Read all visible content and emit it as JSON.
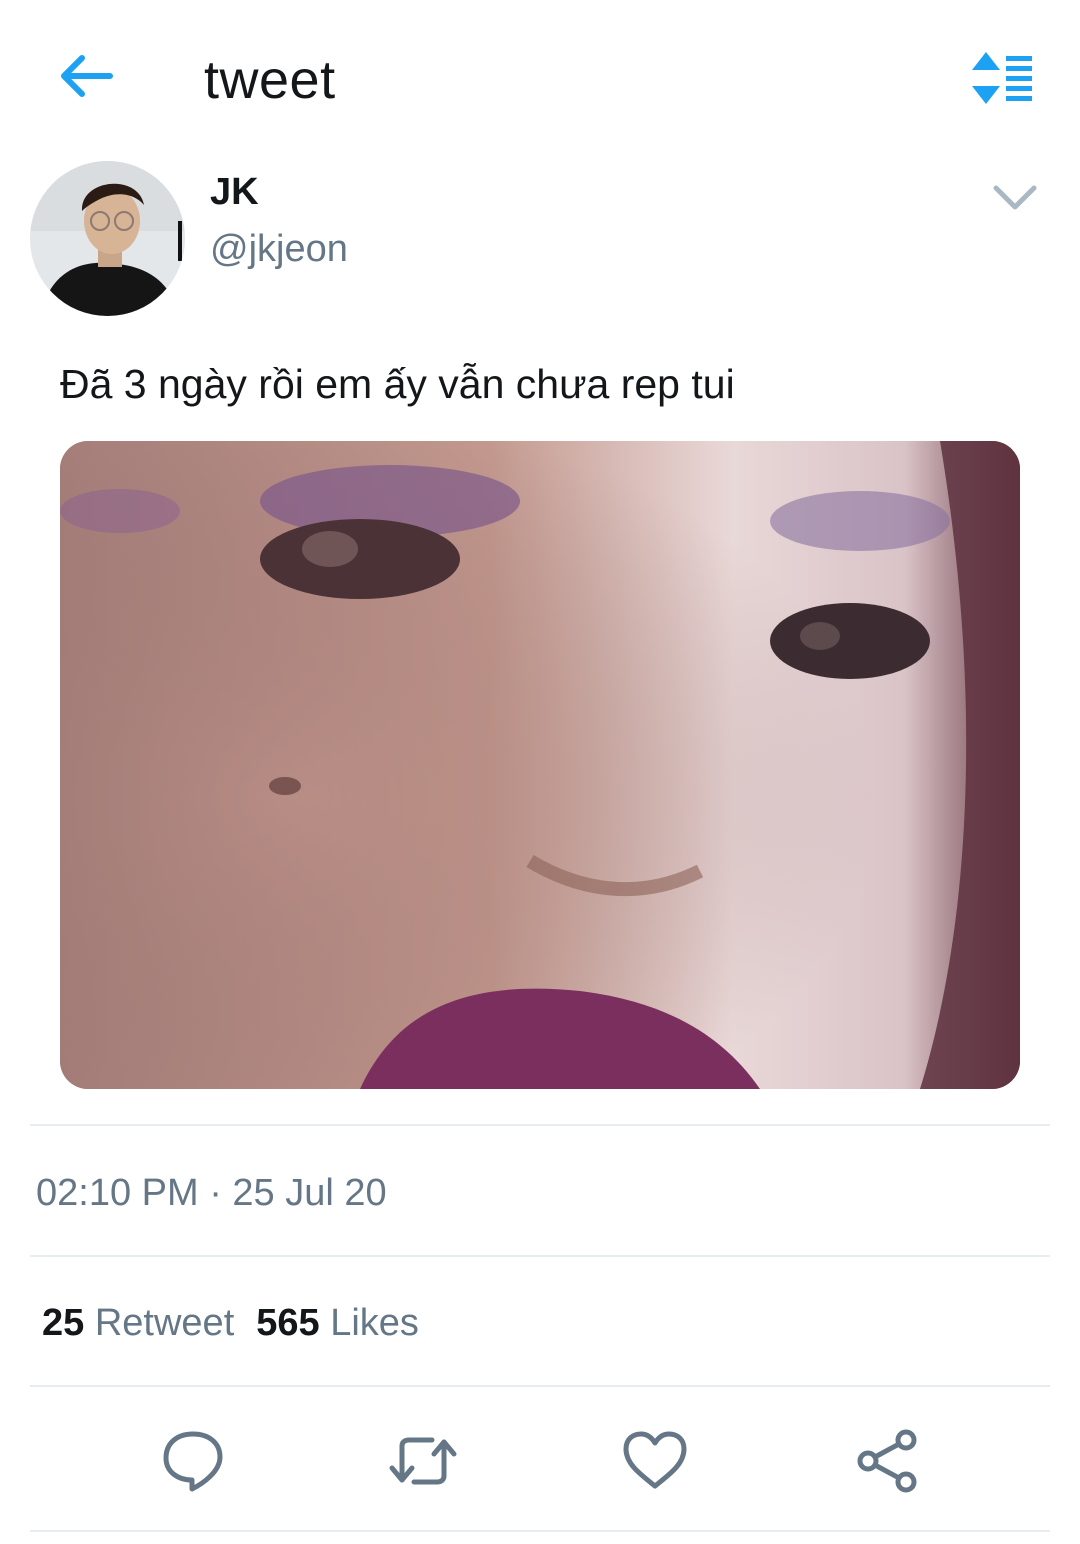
{
  "header": {
    "title": "tweet",
    "back_icon": "arrow-left-icon",
    "sort_icon": "sort-list-icon",
    "accent_color": "#1da1f2"
  },
  "tweet": {
    "author": {
      "name": "JK",
      "handle": "@jkjeon"
    },
    "text": "Đã 3 ngày rồi em ấy vẫn chưa rep tui",
    "timestamp": "02:10 PM · 25 Jul 20",
    "stats": {
      "retweets_count": "25",
      "retweets_label": "Retweet",
      "likes_count": "565",
      "likes_label": "Likes"
    },
    "actions": [
      "reply-icon",
      "retweet-icon",
      "like-icon",
      "share-icon"
    ]
  },
  "colors": {
    "text_primary": "#14171a",
    "text_secondary": "#657786",
    "divider": "#e6ecf0"
  }
}
